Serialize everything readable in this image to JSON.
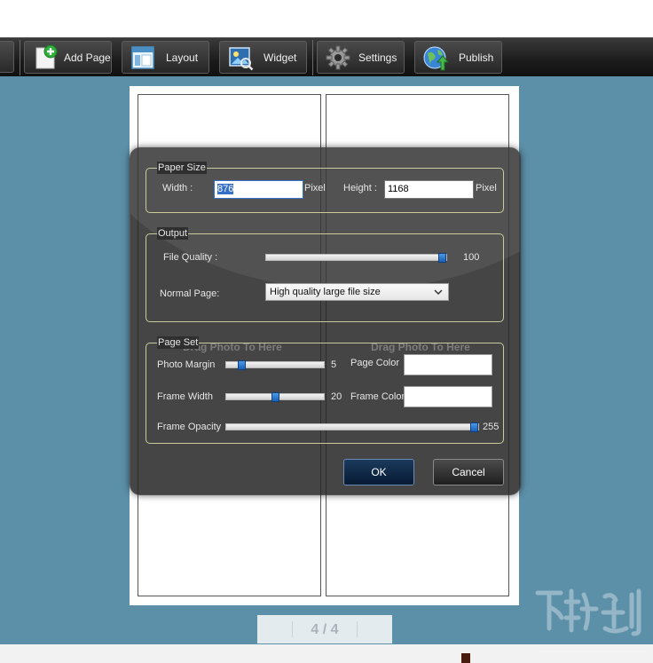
{
  "toolbar": {
    "buttons": [
      {
        "id": "add_page",
        "label": "Add Page",
        "icon": "add-page-icon"
      },
      {
        "id": "layout",
        "label": "Layout",
        "icon": "layout-icon"
      },
      {
        "id": "widget",
        "label": "Widget",
        "icon": "widget-icon"
      },
      {
        "id": "settings",
        "label": "Settings",
        "icon": "gear-icon"
      },
      {
        "id": "publish",
        "label": "Publish",
        "icon": "globe-publish-icon"
      }
    ]
  },
  "canvas": {
    "placeholder_left": "Drag Photo To Here",
    "placeholder_right": "Drag Photo To Here"
  },
  "pager": {
    "current": "4",
    "separator": "/",
    "total": "4"
  },
  "dialog": {
    "paper_size": {
      "legend": "Paper Size",
      "width_label": "Width :",
      "width_value": "876",
      "width_unit": "Pixel",
      "height_label": "Height :",
      "height_value": "1168",
      "height_unit": "Pixel"
    },
    "output": {
      "legend": "Output",
      "file_quality_label": "File Quality :",
      "file_quality_value": "100",
      "file_quality_min": 0,
      "file_quality_max": 100,
      "normal_page_label": "Normal Page:",
      "normal_page_selected": "High quality large file size"
    },
    "page_set": {
      "legend": "Page Set",
      "photo_margin_label": "Photo Margin",
      "photo_margin_value": "5",
      "photo_margin_fraction": 0.13,
      "frame_width_label": "Frame Width",
      "frame_width_value": "20",
      "frame_width_fraction": 0.5,
      "frame_opacity_label": "Frame Opacity",
      "frame_opacity_value": "255",
      "frame_opacity_min": 0,
      "frame_opacity_max": 255,
      "page_color_label": "Page Color",
      "page_color_value": "#ffffff",
      "frame_color_label": "Frame Color",
      "frame_color_value": "#ffffff"
    },
    "ok_label": "OK",
    "cancel_label": "Cancel"
  },
  "colors": {
    "workspace": "#5c8fa8",
    "toolbar": "#1b1b1b",
    "slider_thumb": "#1a5fb8",
    "ok_button": "#0a2444"
  }
}
